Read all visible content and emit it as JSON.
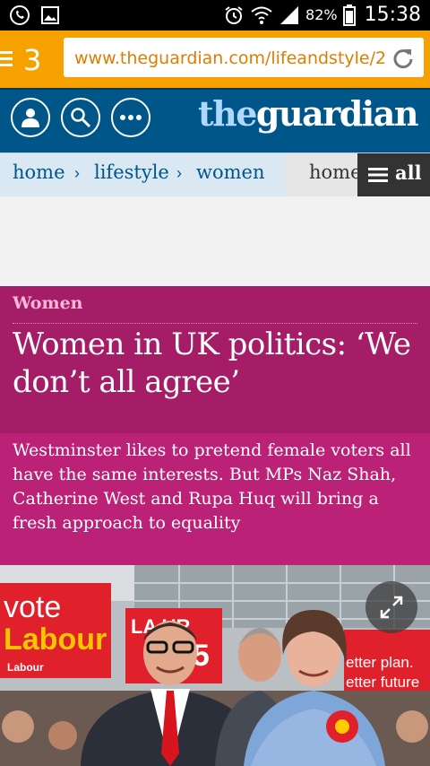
{
  "status_bar": {
    "battery_percent": "82%",
    "time": "15:38",
    "icons": [
      "whatsapp-icon",
      "gallery-icon",
      "alarm-icon",
      "wifi-icon",
      "signal-icon",
      "battery-icon"
    ]
  },
  "browser": {
    "tab_count": "3",
    "url": "www.theguardian.com/lifeandstyle/20'"
  },
  "header": {
    "logo_the": "the",
    "logo_guardian": "guardian",
    "buttons": [
      "profile-icon",
      "search-icon",
      "more-icon"
    ]
  },
  "breadcrumbs": {
    "items": [
      "home",
      "lifestyle",
      "women"
    ],
    "home_short": "home",
    "all_label": "all"
  },
  "article": {
    "section": "Women",
    "title": "Women in UK politics: ‘We don’t all agree’",
    "standfirst": "Westminster likes to pretend female voters all have the same interests. But MPs Naz Shah, Catherine West and Rupa Huq will bring a fresh approach to equality"
  },
  "photo": {
    "sign_vote": "vote",
    "sign_labour": "Labour",
    "sign_labour_small": "Labour",
    "sign_right_line1": "etter plan.",
    "sign_right_line2": "etter future",
    "sign_mid": "LA UR",
    "sign_mid_year": "15"
  },
  "colors": {
    "browser_accent": "#f7a100",
    "guardian_blue": "#005689",
    "headline_bg": "#a41d66",
    "standfirst_bg": "#bb2277"
  }
}
